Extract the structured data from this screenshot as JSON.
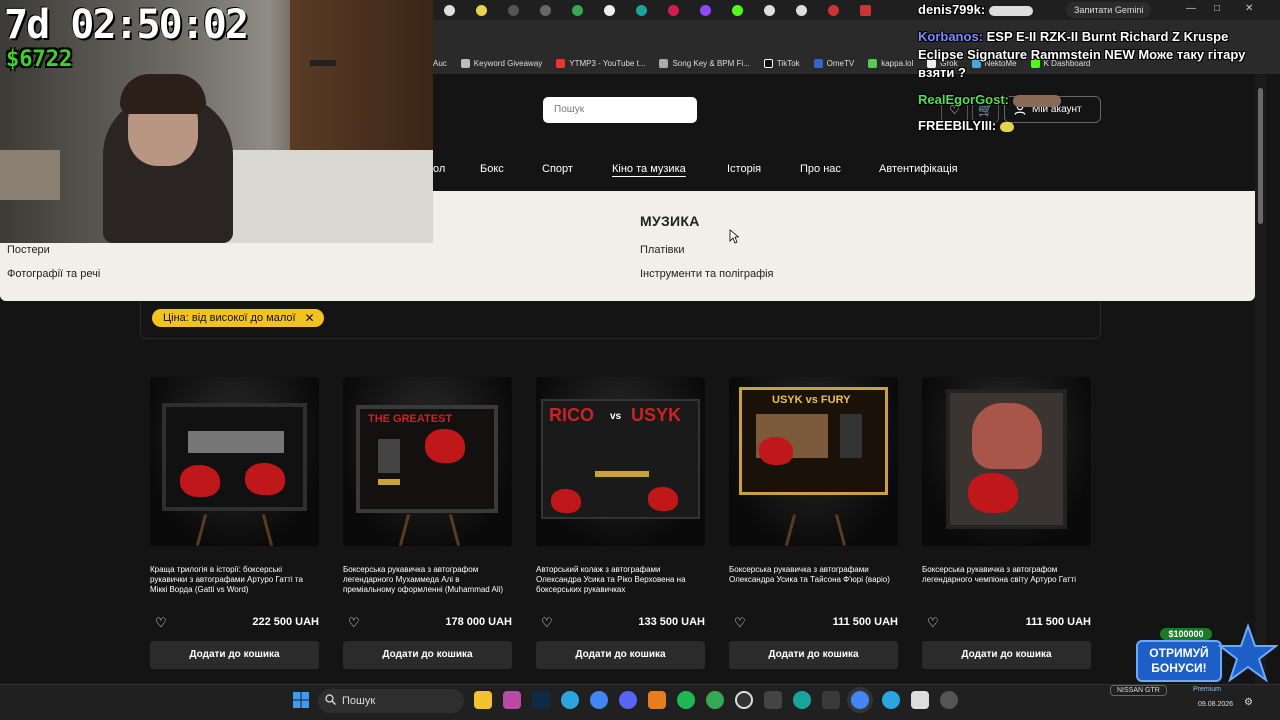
{
  "stream": {
    "timer": "7d 02:50:02",
    "money": "$6722"
  },
  "browser": {
    "gemini_label": "Запитати Gemini",
    "bookmarks": [
      "Auc",
      "Keyword Giveaway",
      "YTMP3 - YouTube t...",
      "Song Key & BPM Fi...",
      "TikTok",
      "OmeTV",
      "kappa.lol",
      "Grok",
      "NektoMe",
      "K Dashboard"
    ]
  },
  "site": {
    "search_placeholder": "Пошук",
    "account_label": "Мій акаунт",
    "nav": [
      "ол",
      "Бокс",
      "Спорт",
      "Кіно та музика",
      "Історія",
      "Про нас",
      "Автентифікація"
    ],
    "dropdown": {
      "left_items": [
        "Постери",
        "Фотографії та речі"
      ],
      "music_heading": "МУЗИКА",
      "music_items": [
        "Платівки",
        "Інструменти та поліграфія"
      ]
    },
    "filter_chip": "Ціна: від високої до малої",
    "add_to_cart": "Додати до кошика",
    "products": [
      {
        "title": "Краща трилогія в історії: боксерські рукавички з автографами Артуро Гатті та Міккі Ворда (Gatti vs Word)",
        "price": "222 500 UAH"
      },
      {
        "title": "Боксерська рукавичка з автографом легендарного Мухаммеда Алі в преміальному оформленні (Muhammad Ali)",
        "price": "178 000 UAH"
      },
      {
        "title": "Авторський колаж з автографами Олександра Усика та Ріко Верховена на боксерських рукавичках",
        "price": "133 500 UAH"
      },
      {
        "title": "Боксерська рукавичка з автографами Олександра Усика та Тайсона Ф'юрі (варіо)",
        "price": "111 500 UAH"
      },
      {
        "title": "Боксерська рукавичка з автографом легендарного чемпіона світу Артуро Гатті",
        "price": "111 500 UAH"
      }
    ],
    "product_image_texts": [
      "THE GREATEST",
      "RICO",
      "vs",
      "USYK",
      "USYK vs FURY"
    ]
  },
  "chat": [
    {
      "name": "denis799k:",
      "message": "",
      "color": "#ffffff"
    },
    {
      "name": "Korbanos:",
      "message": "ESP E-II RZK-II Burnt Richard Z Kruspe Eclipse Signature Rammstein NEW Може таку гітару взяти ?",
      "color": "#7b8cff"
    },
    {
      "name": "RealEgorGost:",
      "message": "",
      "color": "#4fe04f"
    },
    {
      "name": "FREEBILYIII:",
      "message": "",
      "color": "#ffffff"
    }
  ],
  "widget": {
    "amount": "$100000",
    "cta": "ОТРИМУЙ БОНУСИ!"
  },
  "taskbar": {
    "search_label": "Пошук",
    "car_label": "NISSAN GTR",
    "premium_label": "Premium",
    "date": "09.08.2026"
  },
  "colors": {
    "accent_yellow": "#f4c21f",
    "money_green": "#39d429",
    "bonus_blue": "#1e5fc7"
  }
}
